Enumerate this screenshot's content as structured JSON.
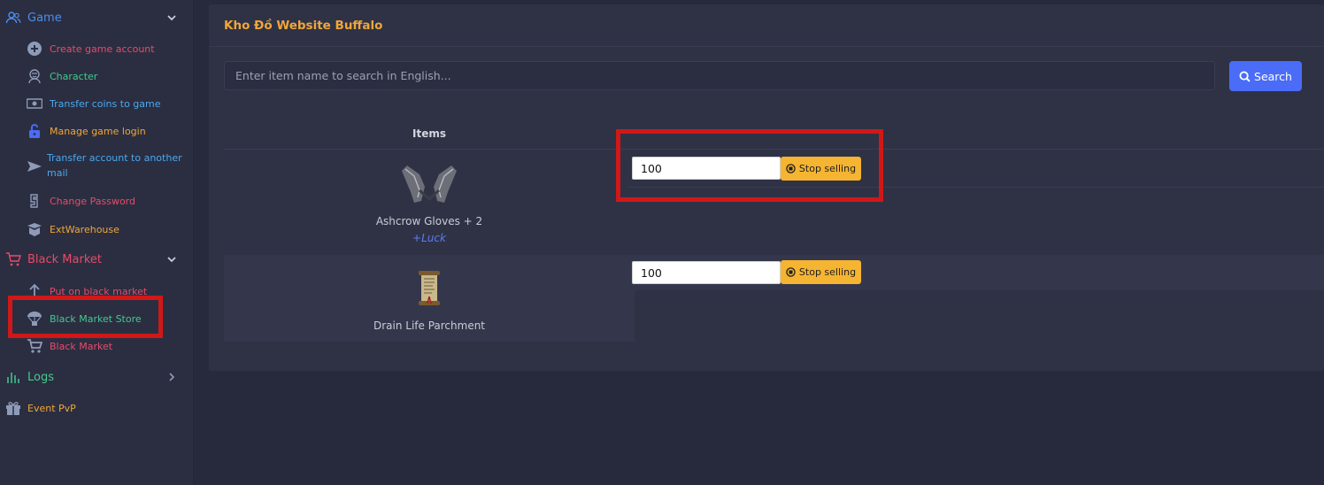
{
  "sidebar": {
    "game": {
      "label": "Game",
      "items": [
        {
          "label": "Create game account",
          "color": "#e84a6a"
        },
        {
          "label": "Character",
          "color": "#43c98f"
        },
        {
          "label": "Transfer coins to game",
          "color": "#4aa8f0"
        },
        {
          "label": "Manage game login",
          "color": "#f0a63a"
        },
        {
          "label": "Transfer account to another mail",
          "color": "#4aa8f0"
        },
        {
          "label": "Change Password",
          "color": "#e84a6a"
        },
        {
          "label": "ExtWarehouse",
          "color": "#f0a63a"
        }
      ]
    },
    "black_market": {
      "label": "Black Market",
      "items": [
        {
          "label": "Put on black market",
          "color": "#e84a6a"
        },
        {
          "label": "Black Market Store",
          "color": "#43c98f"
        },
        {
          "label": "Black Market",
          "color": "#e84a6a"
        }
      ]
    },
    "logs": {
      "label": "Logs"
    },
    "event_pvp": {
      "label": "Event PvP"
    }
  },
  "main": {
    "title": "Kho Đồ Website Buffalo",
    "search": {
      "placeholder": "Enter item name to search in English...",
      "button_label": "Search"
    },
    "table": {
      "header_items": "Items",
      "rows": [
        {
          "name": "Ashcrow Gloves + 2",
          "option": "+Luck",
          "price": "100",
          "action": "Stop selling"
        },
        {
          "name": "Drain Life Parchment",
          "option": "",
          "price": "100",
          "action": "Stop selling"
        }
      ]
    }
  },
  "colors": {
    "accent_blue": "#4a6cf7",
    "stop_button": "#f5b431",
    "title_orange": "#f0a63a",
    "highlight_red": "#d01818"
  }
}
